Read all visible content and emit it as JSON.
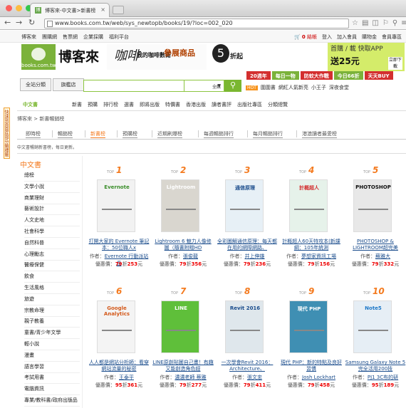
{
  "browser": {
    "tab_title": "博客來-中文書>新書榜",
    "tab_favicon": "博",
    "url": "www.books.com.tw/web/sys_newtopb/books/19/?loc=002_020"
  },
  "topnav": {
    "left": [
      "博客來",
      "團購網",
      "售票網",
      "企業採購",
      "福利平台"
    ],
    "cart_count": "0",
    "cart_label": "結帳",
    "right": [
      "登入",
      "加入會員",
      "購物金",
      "會員專區"
    ]
  },
  "banner": {
    "logo_sub": "books.com.tw",
    "logo_text": "博客來",
    "ad_big": "咖啡",
    "ad_small": "我的咖啡數衛",
    "ad_promo": "參展商品",
    "ad_circle": "5",
    "ad_zhe": "折起",
    "right_line1": "首購 / 載 快取APP",
    "right_line2": "送25元",
    "right_btn": "立即下載"
  },
  "search": {
    "cat_btn": "全站分類",
    "store_btn": "旗艦店",
    "select": "全館",
    "hot_badge": "HOT",
    "hot_items": [
      "圍圍書",
      "網紅人氣新亮",
      "小王子",
      "深夜食堂"
    ]
  },
  "promo": [
    "20週年",
    "每日一物",
    "防蚊大作戰",
    "今日66折",
    "天天BUY"
  ],
  "side_label": "快速到頁面底部分類標籤",
  "categories": {
    "current": "中文書",
    "items": [
      "新書",
      "預購",
      "排行榜",
      "選書",
      "即將出版",
      "特價書",
      "香港出版",
      "讀者書評",
      "出版社專區",
      "分類總覽"
    ]
  },
  "breadcrumb": "博客來 > 新書暢銷榜",
  "subtabs": [
    "即時榜",
    "暢銷榜",
    "新書榜",
    "預購榜",
    "近期刷爆榜",
    "每週暢銷排行",
    "每月暢銷排行",
    "港澳讀者最愛榜"
  ],
  "subtab_active": 2,
  "note": "中文書暢銷新書榜，每日更新。",
  "leftcol": {
    "head": "中文書",
    "items": [
      "總榜",
      "文學小說",
      "商業理財",
      "藝術設計",
      "人文史地",
      "社會科學",
      "自然科普",
      "心理勵志",
      "醫療保健",
      "飲食",
      "生活風格",
      "旅遊",
      "宗教命理",
      "親子教養",
      "童書/青少年文學",
      "輕小說",
      "漫畫",
      "語言學習",
      "考試用書",
      "電腦資訊",
      "專業/教科書/政府出版品"
    ]
  },
  "top_label": "TOP",
  "author_label": "作者：",
  "price_label": "優惠價：",
  "books": [
    {
      "rank": "1",
      "title": "打開大家的 Evernote 筆記本：50位職人x",
      "author": "Evernote 行動派站長",
      "discount": "79",
      "price": "253",
      "cover_color": "#f2f2f2",
      "cover_text": "Evernote",
      "cover_ink": "#3a8d2a"
    },
    {
      "rank": "2",
      "title": "Lightroom 6 魅力人像修圖（隨書附贈HD",
      "author": "張俊龍",
      "discount": "79",
      "price": "356",
      "cover_color": "#d9d6cf",
      "cover_text": "Lightroom",
      "cover_ink": "#ffffff"
    },
    {
      "rank": "3",
      "title": "全彩圖解通信原理：每天都在用的網際網路、",
      "author": "井上伸雄",
      "discount": "79",
      "price": "236",
      "cover_color": "#e7f0f6",
      "cover_text": "通信原理",
      "cover_ink": "#1a4c8c"
    },
    {
      "rank": "4",
      "title": "計概超人60天特攻本(新課綱：105年統測",
      "author": "夢想家資訊工場",
      "discount": "79",
      "price": "156",
      "cover_color": "#e6f2ea",
      "cover_text": "計概超人",
      "cover_ink": "#d32f2f"
    },
    {
      "rank": "5",
      "title": "PHOTOSHOP & LIGHTROOM超完美",
      "author": "蘇雅大",
      "discount": "79",
      "price": "332",
      "cover_color": "#e8e8e8",
      "cover_text": "PHOTOSHOP",
      "cover_ink": "#111111"
    },
    {
      "rank": "6",
      "title": "人人都是網站分析師：看穿網站流量的秘密",
      "author": "王泰平",
      "discount": "95",
      "price": "361",
      "cover_color": "#f4f4f4",
      "cover_text": "Google Analytics",
      "cover_ink": "#d45a1c"
    },
    {
      "rank": "7",
      "title": "LINE原創貼圖自己畫！有趣又能創造角色經",
      "author": "濃濃老師 蔡雅",
      "discount": "79",
      "price": "277",
      "cover_color": "#5fbf3a",
      "cover_text": "LINE",
      "cover_ink": "#ffffff"
    },
    {
      "rank": "8",
      "title": "一次學會Revit 2016：Architecture、",
      "author": "張文忠",
      "discount": "79",
      "price": "411",
      "cover_color": "#dfe7ec",
      "cover_text": "Revit 2016",
      "cover_ink": "#1a4c8c"
    },
    {
      "rank": "9",
      "title": "現代 PHP：新的特點及良好習慣",
      "author": "Josh Lockhart",
      "discount": "79",
      "price": "458",
      "cover_color": "#3f8fb3",
      "cover_text": "現代 PHP",
      "cover_ink": "#ffffff"
    },
    {
      "rank": "10",
      "title": "Samsung Galaxy Note 5 完全活用200技",
      "author": "PJ1 3C布的研",
      "discount": "95",
      "price": "189",
      "cover_color": "#e6eef5",
      "cover_text": "Note5",
      "cover_ink": "#1e78c8"
    }
  ],
  "colors": {
    "accent": "#7ab730",
    "orange": "#f47b20",
    "price": "#e00000",
    "link": "#1a4c8c"
  }
}
